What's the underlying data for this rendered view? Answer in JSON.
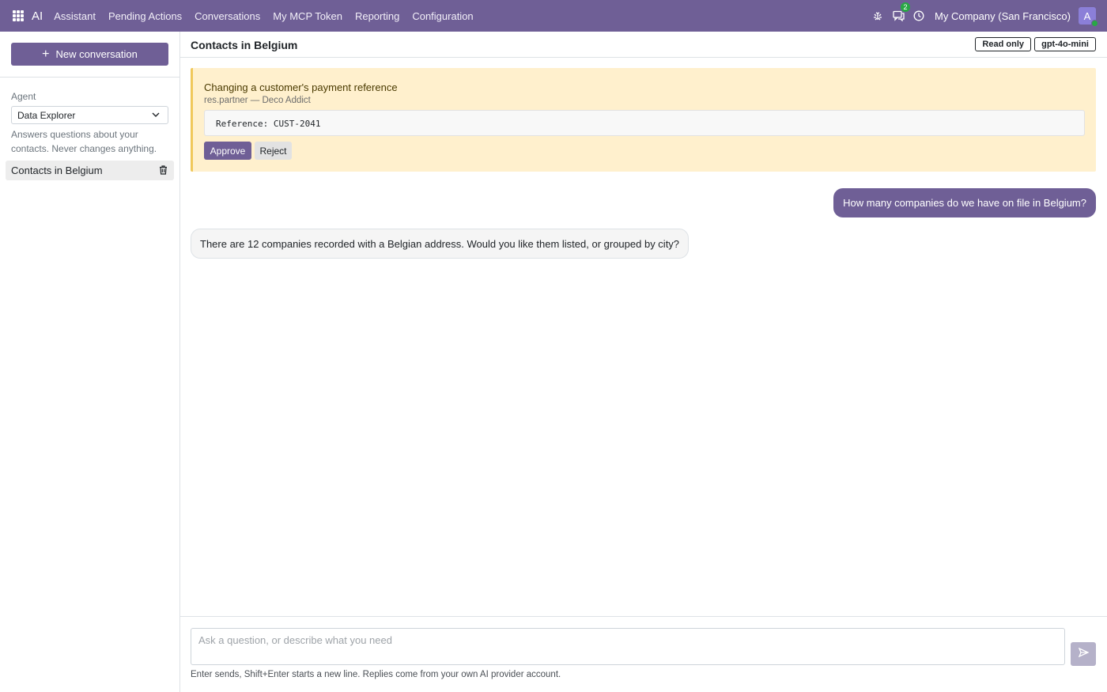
{
  "navbar": {
    "brand": "AI",
    "menu": [
      "Assistant",
      "Pending Actions",
      "Conversations",
      "My MCP Token",
      "Reporting",
      "Configuration"
    ],
    "messages_badge": "2",
    "company": "My Company (San Francisco)",
    "avatar_letter": "A",
    "colors": {
      "bar": "#6f5f96",
      "badge": "#28a745"
    },
    "icons": [
      "apps-icon",
      "bug-icon",
      "chat-icon",
      "clock-icon"
    ]
  },
  "sidebar": {
    "new_conversation_label": "New conversation",
    "agent_label": "Agent",
    "agent_selected": "Data Explorer",
    "agent_description": "Answers questions about your contacts. Never changes anything.",
    "conversations": [
      {
        "title": "Contacts in Belgium",
        "active": true
      }
    ]
  },
  "main": {
    "title": "Contacts in Belgium",
    "tags": {
      "mode": "Read only",
      "model": "gpt-4o-mini"
    },
    "pending_action": {
      "title": "Changing a customer's payment reference",
      "subtitle": "res.partner — Deco Addict",
      "code": "Reference: CUST-2041",
      "approve_label": "Approve",
      "reject_label": "Reject"
    },
    "messages": [
      {
        "role": "user",
        "text": "How many companies do we have on file in Belgium?"
      },
      {
        "role": "assistant",
        "text": "There are 12 companies recorded with a Belgian address. Would you like them listed, or grouped by city?"
      }
    ],
    "composer": {
      "placeholder": "Ask a question, or describe what you need",
      "value": "",
      "hint": "Enter sends, Shift+Enter starts a new line. Replies come from your own AI provider account."
    }
  }
}
